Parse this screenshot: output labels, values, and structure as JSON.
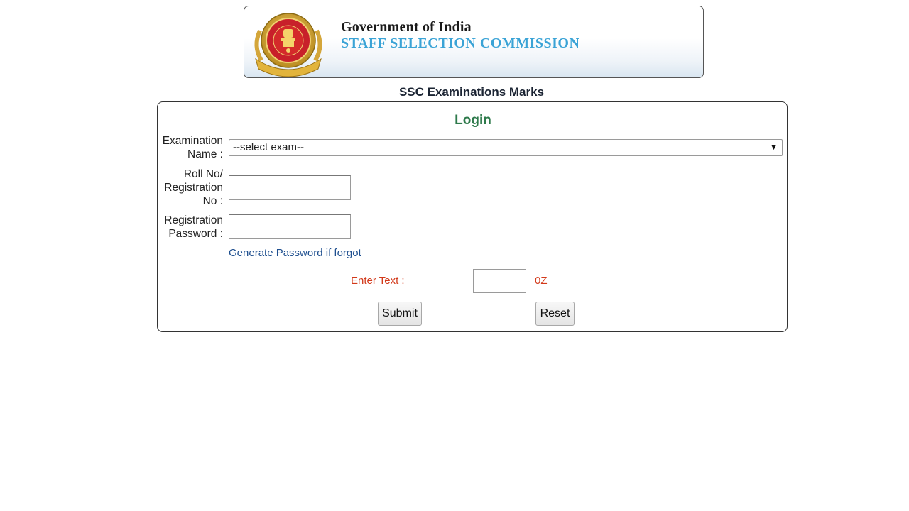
{
  "header": {
    "line1": "Government of India",
    "line2": "STAFF SELECTION COMMISSION",
    "emblem_icon": "ssc-emblem-icon"
  },
  "page_title": "SSC Examinations Marks",
  "form": {
    "title": "Login",
    "exam_label_1": "Examination",
    "exam_label_2": "Name :",
    "exam_select_value": "--select exam--",
    "roll_label_1": "Roll No/",
    "roll_label_2": "Registration",
    "roll_label_3": "No :",
    "password_label_1": "Registration",
    "password_label_2": "Password :",
    "forgot_link": "Generate Password if forgot",
    "captcha_label": "Enter Text :",
    "captcha_code": "0Z",
    "submit_label": "Submit",
    "reset_label": "Reset"
  },
  "colors": {
    "login_title": "#2e7a4b",
    "banner_accent": "#3aa3d6",
    "captcha_text": "#d2391a",
    "link": "#1e4f8f"
  }
}
